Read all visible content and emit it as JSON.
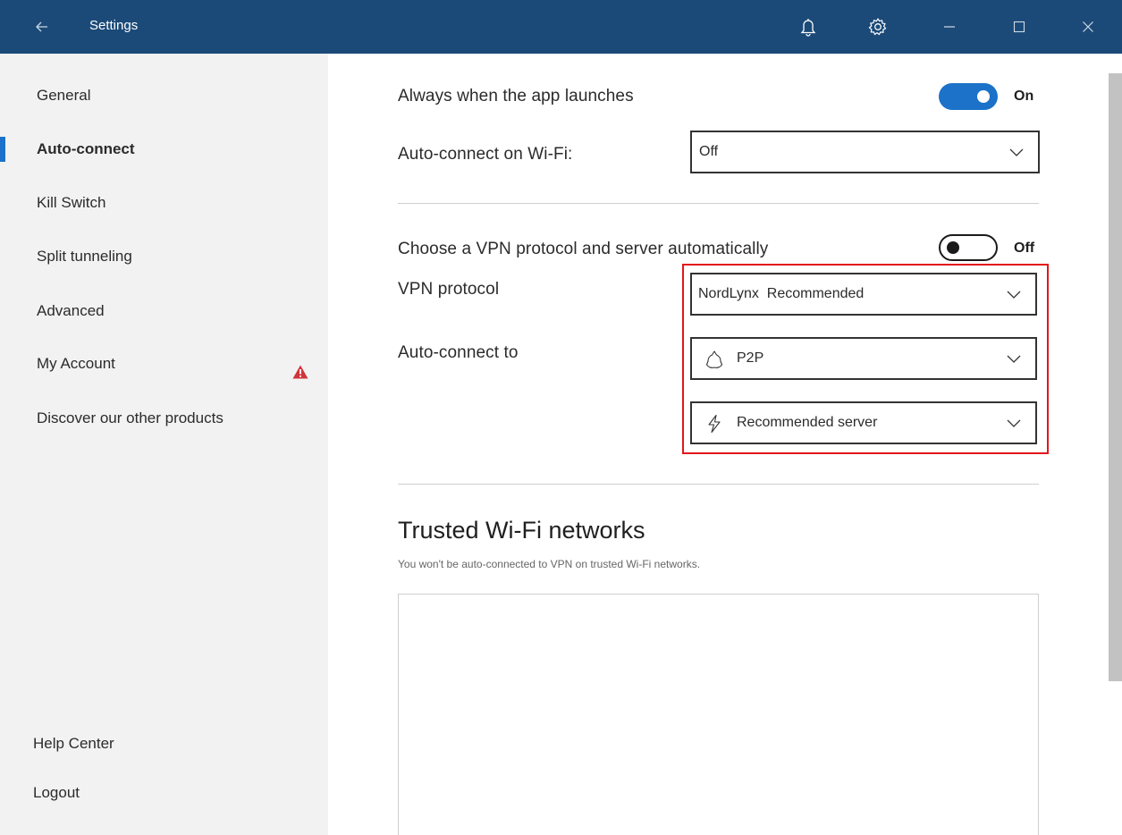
{
  "titlebar": {
    "back_icon": "arrow-left-icon",
    "title": "Settings",
    "icons": [
      "bell-icon",
      "gear-icon",
      "minimize-icon",
      "maximize-icon",
      "close-icon"
    ]
  },
  "sidebar": {
    "items": [
      {
        "label": "General"
      },
      {
        "label": "Auto-connect"
      },
      {
        "label": "Kill Switch"
      },
      {
        "label": "Split tunneling"
      },
      {
        "label": "Advanced"
      },
      {
        "label": "My Account"
      },
      {
        "label": "Discover our other products"
      }
    ],
    "active_index": 1,
    "footer": [
      {
        "label": "Help Center"
      },
      {
        "label": "Logout"
      }
    ]
  },
  "main": {
    "launch": {
      "label": "Always when the app launches",
      "toggle_state": "On"
    },
    "wifi": {
      "label": "Auto-connect on Wi-Fi:",
      "value": "Off"
    },
    "auto_choose": {
      "label": "Choose a VPN protocol and server automatically",
      "toggle_state": "Off"
    },
    "protocol": {
      "label": "VPN protocol",
      "value": "NordLynx",
      "tag": "Recommended"
    },
    "connect_to": {
      "label": "Auto-connect to",
      "server_type": "P2P",
      "server": "Recommended server"
    },
    "trusted": {
      "title": "Trusted Wi-Fi networks",
      "subtitle": "You won't be auto-connected to VPN on trusted Wi-Fi networks."
    }
  },
  "colors": {
    "titlebar_bg": "#1b4a78",
    "accent": "#1b72c8",
    "highlight_border": "#e3161b",
    "warning": "#d13438",
    "sidebar_bg": "#f2f2f2"
  }
}
